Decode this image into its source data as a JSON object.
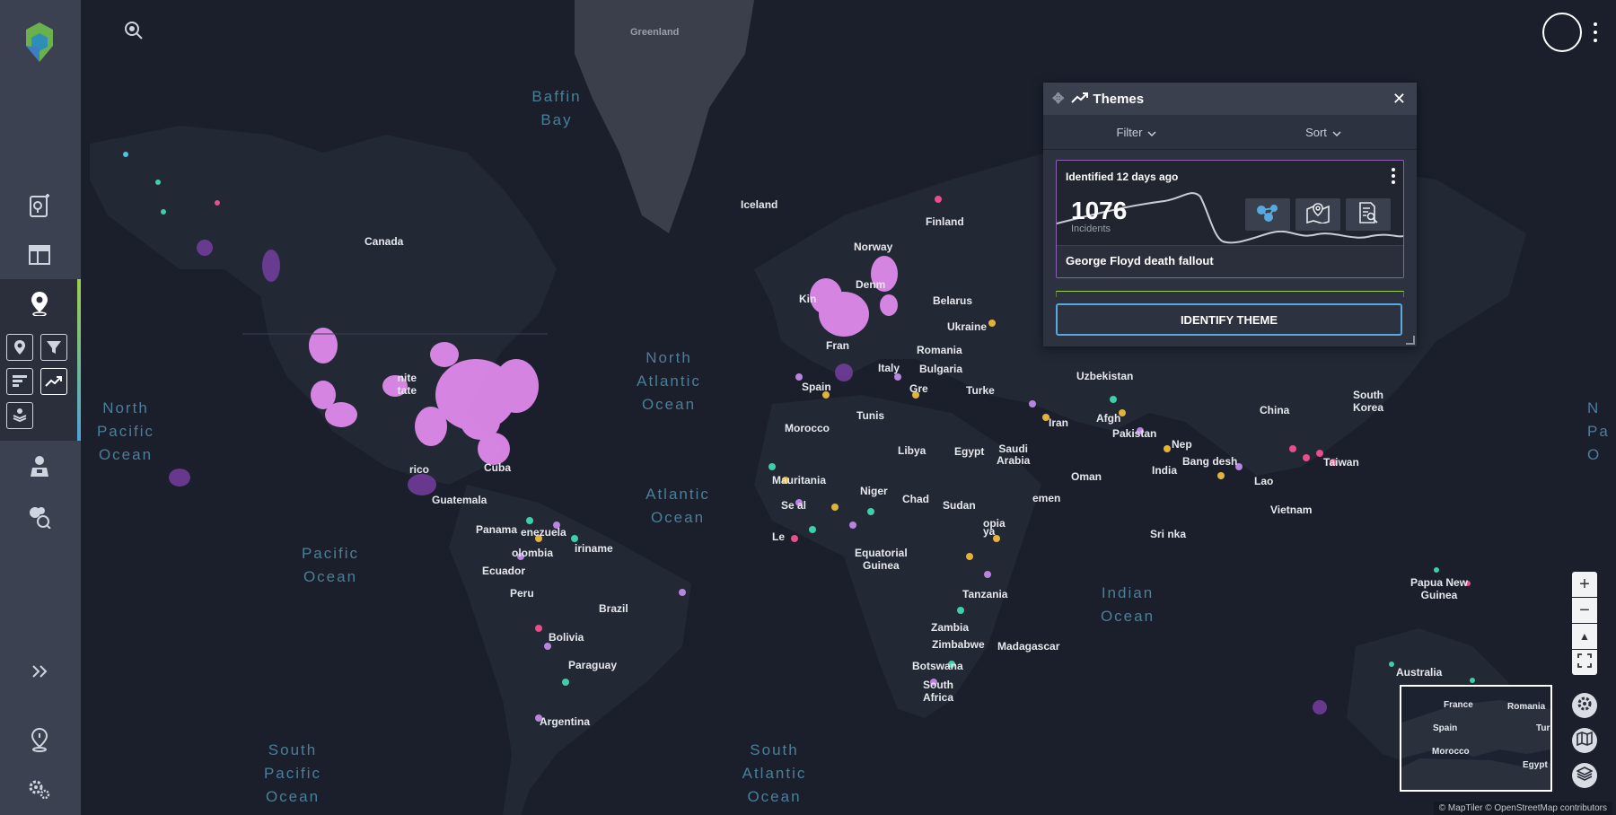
{
  "map_labels": {
    "greenland": "Greenland",
    "canada": "Canada",
    "iceland": "Iceland",
    "finland": "Finland",
    "norway": "Norway",
    "denmark": "Denm",
    "kingdom": "Kin",
    "belarus": "Belarus",
    "ukraine": "Ukraine",
    "france": "Fran",
    "italy": "Italy",
    "romania": "Romania",
    "bulgaria": "Bulgaria",
    "greece": "Gre",
    "turkey": "Turke",
    "spain": "Spain",
    "morocco": "Morocco",
    "tunisia": "Tunis",
    "libya": "Libya",
    "egypt": "Egypt",
    "saudi_arabia": "Saudi\nArabia",
    "iran": "Iran",
    "uzbekistan": "Uzbekistan",
    "afghanistan": "Afgh",
    "pakistan": "Pakistan",
    "china": "China",
    "south_korea": "South\nKorea",
    "taiwan": "Taiwan",
    "nepal": "Nep",
    "bangladesh": "Bang  desh",
    "india": "India",
    "laos": "Lao",
    "vietnam": "Vietnam",
    "sri_lanka": "Sri  nka",
    "oman": "Oman",
    "yemen": "emen",
    "mauritania": "Mauritania",
    "niger": "Niger",
    "chad": "Chad",
    "sudan": "Sudan",
    "senegal": "Se  al",
    "liberia": "Le",
    "ethiopia": "  opia",
    "kenya": "  ya",
    "tanzania": "Tanzania",
    "equatorial_guinea": "Equatorial\nGuinea",
    "zambia": "Zambia",
    "zimbabwe": "Zimbabwe",
    "madagascar": "Madagascar",
    "botswana": "Botswana",
    "south_africa": "South\nAfrica",
    "mexico": "  rico",
    "cuba": "Cuba",
    "guatemala": "Guatemala",
    "panama": "Panama",
    "venezuela": "  enezuela",
    "suriname": "  iriname",
    "colombia": "  olombia",
    "ecuador": "Ecuador",
    "peru": "Peru",
    "brazil": "Brazil",
    "bolivia": "Bolivia",
    "paraguay": "Paraguay",
    "argentina": "Argentina",
    "papua_new_guinea": "Papua New\nGuinea",
    "australia": "Australia",
    "united_states": "  nite\n  tate"
  },
  "oceans": {
    "baffin": "Baffin\nBay",
    "north_pacific": "North\nPacific\nOcean",
    "north_atlantic": "North\nAtlantic\nOcean",
    "atlantic": "Atlantic\nOcean",
    "pacific": "Pacific\nOcean",
    "indian": "Indian\nOcean",
    "south_pacific": "South\nPacific\nOcean",
    "south_atlantic": "South\nAtlantic\nOcean",
    "far_right": "N\nPa\nO"
  },
  "panel": {
    "title": "Themes",
    "filter_label": "Filter",
    "sort_label": "Sort",
    "card": {
      "identified": "Identified 12 days ago",
      "count": "1076",
      "count_label": "Incidents",
      "name": "George Floyd death fallout"
    },
    "identify_button": "IDENTIFY THEME"
  },
  "minimap": {
    "france": "France",
    "romania": "Romania",
    "spain": "Spain",
    "morocco": "Morocco",
    "egypt": "Egypt",
    "tur": "Tur"
  },
  "attribution": "© MapTiler © OpenStreetMap contributors",
  "icons": {
    "logo": "app-logo-icon",
    "search": "map-search-icon",
    "add_report": "add-report-icon",
    "dashboard": "dashboard-icon",
    "location": "location-icon",
    "pin_filter": "pin-icon",
    "filter": "filter-icon",
    "list": "list-icon",
    "trending": "trending-icon",
    "layers": "layers-stack-icon",
    "agent": "agent-icon",
    "network": "network-icon",
    "expand": "expand-sidebar-icon",
    "pin_settings": "pin-settings-icon",
    "settings": "settings-icon"
  },
  "colors": {
    "sidebar": "#3b4150",
    "map_bg": "#1a1f2b",
    "heat": "#e58cf0",
    "accent_blue": "#57a9e0",
    "card_border": "#8d5db5"
  }
}
